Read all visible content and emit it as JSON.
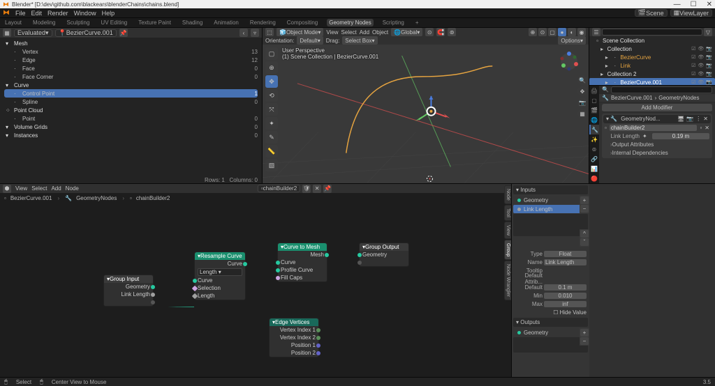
{
  "titlebar": {
    "text": "Blender* [D:\\dev\\github.com\\blackears\\blenderChains\\chains.blend]"
  },
  "menubar": {
    "items": [
      "File",
      "Edit",
      "Render",
      "Window",
      "Help"
    ],
    "scene_label": "Scene",
    "viewlayer_label": "ViewLayer"
  },
  "workspace_tabs": [
    "Layout",
    "Modeling",
    "Sculpting",
    "UV Editing",
    "Texture Paint",
    "Shading",
    "Animation",
    "Rendering",
    "Compositing",
    "Geometry Nodes",
    "Scripting",
    "+"
  ],
  "workspace_active": "Geometry Nodes",
  "spreadsheet": {
    "evaluated": "Evaluated",
    "object": "BezierCurve.001",
    "rows_label": "Rows: 1",
    "cols_label": "Columns: 0",
    "items": [
      {
        "icon": "▾",
        "label": "Mesh",
        "val": "",
        "head": true
      },
      {
        "icon": "·",
        "label": "Vertex",
        "val": "13"
      },
      {
        "icon": "·",
        "label": "Edge",
        "val": "12"
      },
      {
        "icon": "·",
        "label": "Face",
        "val": "0"
      },
      {
        "icon": "·",
        "label": "Face Corner",
        "val": "0"
      },
      {
        "icon": "▾",
        "label": "Curve",
        "val": "",
        "head": true
      },
      {
        "icon": "·",
        "label": "Control Point",
        "val": "1",
        "sel": true
      },
      {
        "icon": "·",
        "label": "Spline",
        "val": "0"
      },
      {
        "icon": "⁘",
        "label": "Point Cloud",
        "val": "",
        "head": true
      },
      {
        "icon": "·",
        "label": "Point",
        "val": "0"
      },
      {
        "icon": "▾",
        "label": "Volume Grids",
        "val": "0",
        "head": true
      },
      {
        "icon": "▾",
        "label": "Instances",
        "val": "0",
        "head": true
      }
    ]
  },
  "view3d": {
    "header": {
      "mode": "Object Mode",
      "menus": [
        "View",
        "Select",
        "Add",
        "Object"
      ],
      "global": "Global",
      "orientation_label": "Orientation:",
      "orientation_value": "Default",
      "drag_label": "Drag:",
      "drag_value": "Select Box",
      "options": "Options"
    },
    "info": {
      "l1": "User Perspective",
      "l2": "(1) Scene Collection | BezierCurve.001"
    }
  },
  "outliner": {
    "search_placeholder": "",
    "tree": [
      {
        "ind": 0,
        "icon": "▫",
        "label": "Scene Collection",
        "col": "#e0e0e0"
      },
      {
        "ind": 1,
        "icon": "▸",
        "label": "Collection",
        "col": "#e0e0e0",
        "restrict": true
      },
      {
        "ind": 2,
        "icon": "·",
        "label": "BezierCurve",
        "col": "#e6a440",
        "restrict": true,
        "bullet": "▸"
      },
      {
        "ind": 2,
        "icon": "·",
        "label": "Link",
        "col": "#e6a440",
        "restrict": true,
        "bullet": "▸"
      },
      {
        "ind": 1,
        "icon": "▸",
        "label": "Collection 2",
        "col": "#e0e0e0",
        "restrict": true
      },
      {
        "ind": 2,
        "icon": "·",
        "label": "BezierCurve.001",
        "col": "#fff",
        "restrict": true,
        "sel": true,
        "bullet": "▸"
      }
    ]
  },
  "properties": {
    "bc": [
      "BezierCurve.001",
      "GeometryNodes"
    ],
    "add_modifier": "Add Modifier",
    "mod_name": "GeometryNod...",
    "node_group": "chainBuilder2",
    "link_length_label": "Link Length",
    "link_length_value": "0.19 m",
    "output_attrs": "Output Attributes",
    "internal_deps": "Internal Dependencies"
  },
  "node_editor": {
    "menus": [
      "View",
      "Select",
      "Add",
      "Node"
    ],
    "group_name": "chainBuilder2",
    "breadcrumb": [
      "BezierCurve.001",
      "GeometryNodes",
      "chainBuilder2"
    ],
    "nodes": {
      "group_input": {
        "title": "Group Input",
        "out1": "Geometry",
        "out2": "Link Length"
      },
      "resample": {
        "title": "Resample Curve",
        "out": "Curve",
        "mode": "Length",
        "in1": "Curve",
        "in2": "Selection",
        "in3": "Length"
      },
      "curve2mesh": {
        "title": "Curve to Mesh",
        "out": "Mesh",
        "in1": "Curve",
        "in2": "Profile Curve",
        "in3": "Fill Caps"
      },
      "group_output": {
        "title": "Group Output",
        "in": "Geometry"
      },
      "edge_verts": {
        "title": "Edge Vertices",
        "o1": "Vertex Index 1",
        "o2": "Vertex Index 2",
        "o3": "Position 1",
        "o4": "Position 2"
      }
    },
    "sidebar": {
      "inputs": "Inputs",
      "outputs": "Outputs",
      "geo": "Geometry",
      "linklen": "Link Length",
      "type_label": "Type",
      "type_val": "Float",
      "name_label": "Name",
      "name_val": "Link Length",
      "tooltip_label": "Tooltip",
      "default_attr": "Default Attrib...",
      "default_label": "Default",
      "default_val": "0.1 m",
      "min_label": "Min",
      "min_val": "0.010",
      "max_label": "Max",
      "max_val": "inf",
      "hide_val": "Hide Value"
    }
  },
  "status": {
    "select": "Select",
    "center": "Center View to Mouse",
    "version": "3.5"
  }
}
